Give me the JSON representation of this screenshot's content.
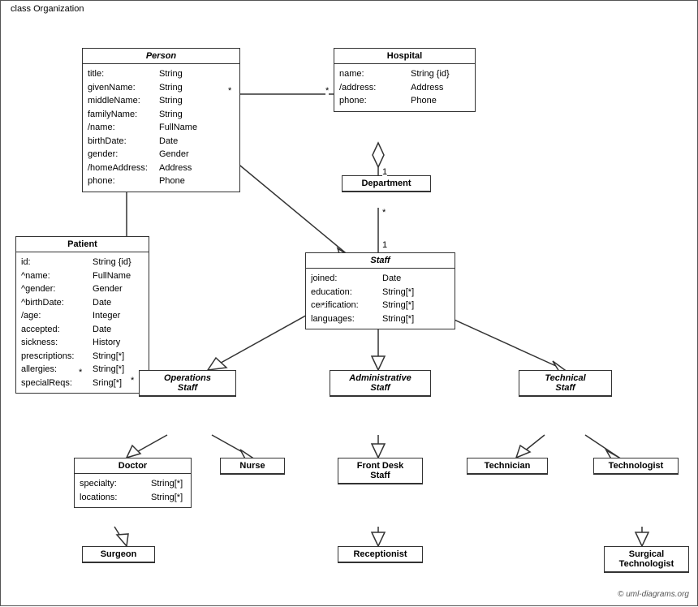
{
  "diagram": {
    "title": "class Organization",
    "copyright": "© uml-diagrams.org",
    "classes": {
      "person": {
        "name": "Person",
        "italic": true,
        "attrs": [
          [
            "title:",
            "String"
          ],
          [
            "givenName:",
            "String"
          ],
          [
            "middleName:",
            "String"
          ],
          [
            "familyName:",
            "String"
          ],
          [
            "/name:",
            "FullName"
          ],
          [
            "birthDate:",
            "Date"
          ],
          [
            "gender:",
            "Gender"
          ],
          [
            "/homeAddress:",
            "Address"
          ],
          [
            "phone:",
            "Phone"
          ]
        ]
      },
      "hospital": {
        "name": "Hospital",
        "italic": false,
        "attrs": [
          [
            "name:",
            "String {id}"
          ],
          [
            "/address:",
            "Address"
          ],
          [
            "phone:",
            "Phone"
          ]
        ]
      },
      "department": {
        "name": "Department",
        "italic": false,
        "attrs": []
      },
      "staff": {
        "name": "Staff",
        "italic": true,
        "attrs": [
          [
            "joined:",
            "Date"
          ],
          [
            "education:",
            "String[*]"
          ],
          [
            "certification:",
            "String[*]"
          ],
          [
            "languages:",
            "String[*]"
          ]
        ]
      },
      "patient": {
        "name": "Patient",
        "italic": false,
        "attrs": [
          [
            "id:",
            "String {id}"
          ],
          [
            "^name:",
            "FullName"
          ],
          [
            "^gender:",
            "Gender"
          ],
          [
            "^birthDate:",
            "Date"
          ],
          [
            "/age:",
            "Integer"
          ],
          [
            "accepted:",
            "Date"
          ],
          [
            "sickness:",
            "History"
          ],
          [
            "prescriptions:",
            "String[*]"
          ],
          [
            "allergies:",
            "String[*]"
          ],
          [
            "specialReqs:",
            "Sring[*]"
          ]
        ]
      },
      "operations_staff": {
        "name": "Operations Staff",
        "italic": true,
        "attrs": []
      },
      "administrative_staff": {
        "name": "Administrative Staff",
        "italic": true,
        "attrs": []
      },
      "technical_staff": {
        "name": "Technical Staff",
        "italic": true,
        "attrs": []
      },
      "doctor": {
        "name": "Doctor",
        "italic": false,
        "attrs": [
          [
            "specialty:",
            "String[*]"
          ],
          [
            "locations:",
            "String[*]"
          ]
        ]
      },
      "nurse": {
        "name": "Nurse",
        "italic": false,
        "attrs": []
      },
      "front_desk_staff": {
        "name": "Front Desk Staff",
        "italic": false,
        "attrs": []
      },
      "technician": {
        "name": "Technician",
        "italic": false,
        "attrs": []
      },
      "technologist": {
        "name": "Technologist",
        "italic": false,
        "attrs": []
      },
      "surgeon": {
        "name": "Surgeon",
        "italic": false,
        "attrs": []
      },
      "receptionist": {
        "name": "Receptionist",
        "italic": false,
        "attrs": []
      },
      "surgical_technologist": {
        "name": "Surgical Technologist",
        "italic": false,
        "attrs": []
      }
    }
  }
}
